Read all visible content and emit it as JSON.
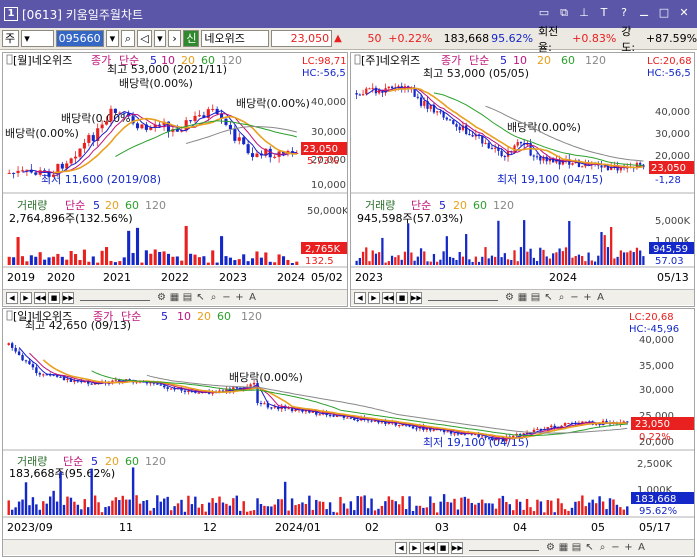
{
  "window": {
    "number": "1",
    "title": "[0613] 키움일주월차트",
    "buttons": [
      "▭",
      "⧉",
      "⊥",
      "T",
      "?",
      "⚊",
      "□",
      "✕"
    ]
  },
  "toolbar": {
    "market": "주",
    "code": "095660",
    "sin": "신",
    "name": "네오위즈",
    "price": "23,050",
    "arrow": "▲",
    "change": "50",
    "change_pct": "+0.22%",
    "volume": "183,668",
    "volume_pct": "95.62%",
    "turnover_label": "회전율:",
    "turnover": "+0.83%",
    "strength_label": "강도:",
    "strength": "+87.59%"
  },
  "colors": {
    "up": "#e8201f",
    "down": "#1428c8",
    "ma5": "#1c1cc8",
    "ma10": "#c0147a",
    "ma20": "#e8a01e",
    "ma60": "#2ca02c",
    "ma120": "#888888"
  },
  "panes": {
    "monthly": {
      "title": "[월]네오위즈",
      "legend": [
        "종가",
        "단순",
        "5",
        "10",
        "20",
        "60",
        "120"
      ],
      "lc": "LC:98,71",
      "hc": "HC:-56,5",
      "high_ann": "최고 53,000 (2021/11)",
      "low_ann": "최저 11,600 (2019/08)",
      "div_ann": "배당락(0.00%)",
      "price_tag": "23,050",
      "pct_tag": "5.73%",
      "yticks": [
        "40,000",
        "30,000",
        "20,000",
        "10,000"
      ],
      "vol_title": "거래량",
      "vol_legend": [
        "단순",
        "5",
        "20",
        "60",
        "120"
      ],
      "vol_info": "2,764,896주(132.56%)",
      "vol_ticks": [
        "50,000K"
      ],
      "vol_tag1": "2,765K",
      "vol_tag2": "132.5",
      "xlabels": [
        "2019",
        "2020",
        "2021",
        "2022",
        "2023",
        "2024"
      ],
      "x_end": "05/02"
    },
    "weekly": {
      "title": "[주]네오위즈",
      "legend": [
        "종가",
        "단순",
        "5",
        "10",
        "20",
        "60",
        "120"
      ],
      "lc": "LC:20,68",
      "hc": "HC:-56,5",
      "high_ann": "최고 53,000 (05/05)",
      "low_ann": "최저 19,100 (04/15)",
      "div_ann": "배당락(0.00%)",
      "price_tag": "23,050",
      "pct_tag": "-1,28",
      "yticks": [
        "40,000",
        "30,000",
        "20,000"
      ],
      "vol_title": "거래량",
      "vol_legend": [
        "단순",
        "5",
        "20",
        "60",
        "120"
      ],
      "vol_info": "945,598주(57.03%)",
      "vol_ticks": [
        "5,000K",
        "1,000K"
      ],
      "vol_tag1": "945,59",
      "vol_tag2": "57.03",
      "xlabels": [
        "2023",
        "2024"
      ],
      "x_end": "05/13"
    },
    "daily": {
      "title": "[일]네오위즈",
      "legend": [
        "종가",
        "단순",
        "5",
        "10",
        "20",
        "60",
        "120"
      ],
      "lc": "LC:20,68",
      "hc": "HC:-45,96",
      "high_ann": "최고 42,650 (09/13)",
      "low_ann": "최저 19,100 (04/15)",
      "div_ann": "배당락(0.00%)",
      "price_tag": "23,050",
      "pct_tag": "0.22%",
      "yticks": [
        "40,000",
        "35,000",
        "30,000",
        "25,000",
        "20,000"
      ],
      "vol_title": "거래량",
      "vol_legend": [
        "단순",
        "5",
        "20",
        "60",
        "120"
      ],
      "vol_info": "183,668주(95.62%)",
      "vol_ticks": [
        "2,500K",
        "1,000K"
      ],
      "vol_tag1": "183,668",
      "vol_tag2": "95.62%",
      "xlabels": [
        "2023/09",
        "11",
        "12",
        "2024/01",
        "02",
        "03",
        "04",
        "05"
      ],
      "x_end": "05/17"
    }
  }
}
